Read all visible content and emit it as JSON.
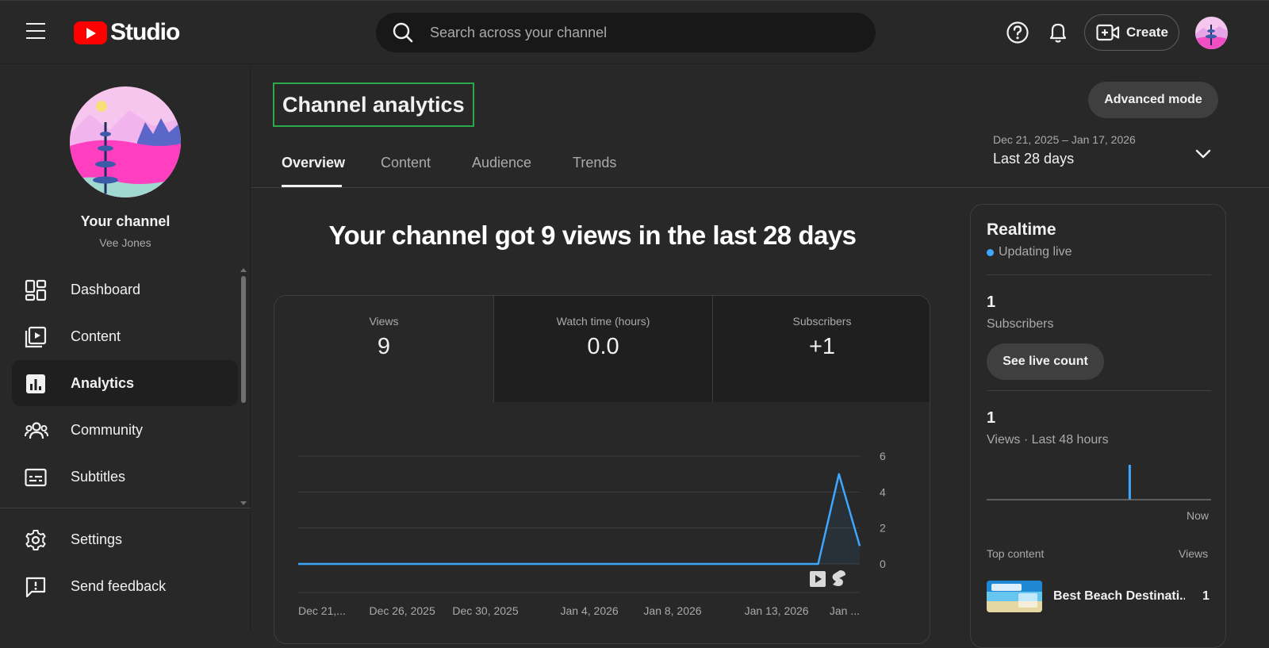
{
  "header": {
    "logo_text": "Studio",
    "search_placeholder": "Search across your channel",
    "create_label": "Create"
  },
  "sidebar": {
    "channel_title": "Your channel",
    "channel_name": "Vee Jones",
    "items": [
      {
        "label": "Dashboard",
        "icon": "dashboard-icon",
        "active": false
      },
      {
        "label": "Content",
        "icon": "content-icon",
        "active": false
      },
      {
        "label": "Analytics",
        "icon": "analytics-icon",
        "active": true
      },
      {
        "label": "Community",
        "icon": "community-icon",
        "active": false
      },
      {
        "label": "Subtitles",
        "icon": "subtitles-icon",
        "active": false
      }
    ],
    "bottom_items": [
      {
        "label": "Settings",
        "icon": "gear-icon"
      },
      {
        "label": "Send feedback",
        "icon": "feedback-icon"
      }
    ]
  },
  "main": {
    "title": "Channel analytics",
    "advanced_mode_label": "Advanced mode",
    "tabs": [
      {
        "label": "Overview",
        "active": true
      },
      {
        "label": "Content",
        "active": false
      },
      {
        "label": "Audience",
        "active": false
      },
      {
        "label": "Trends",
        "active": false
      }
    ],
    "date_range": "Dec 21, 2025 – Jan 17, 2026",
    "date_label": "Last 28 days",
    "headline": "Your channel got 9 views in the last 28 days",
    "metrics": [
      {
        "label": "Views",
        "value": "9"
      },
      {
        "label": "Watch time (hours)",
        "value": "0.0"
      },
      {
        "label": "Subscribers",
        "value": "+1"
      }
    ]
  },
  "chart_data": {
    "type": "area",
    "title": "",
    "xlabel": "",
    "ylabel": "",
    "ylim": [
      0,
      6
    ],
    "yticks": [
      "0",
      "2",
      "4",
      "6"
    ],
    "xtick_labels": [
      "Dec 21,...",
      "Dec 26, 2025",
      "Dec 30, 2025",
      "Jan 4, 2026",
      "Jan 8, 2026",
      "Jan 13, 2026",
      "Jan ..."
    ],
    "x": [
      1,
      2,
      3,
      4,
      5,
      6,
      7,
      8,
      9,
      10,
      11,
      12,
      13,
      14,
      15,
      16,
      17,
      18,
      19,
      20,
      21,
      22,
      23,
      24,
      25,
      26,
      27,
      28
    ],
    "values": [
      0,
      0,
      0,
      0,
      0,
      0,
      0,
      0,
      0,
      0,
      0,
      0,
      0,
      0,
      0,
      0,
      0,
      0,
      0,
      0,
      0,
      0,
      0,
      0,
      0,
      0,
      5,
      1
    ],
    "series_color": "#3ea6ff",
    "grid": true,
    "axis_side": "right"
  },
  "realtime": {
    "title": "Realtime",
    "live_text": "Updating live",
    "subscribers_value": "1",
    "subscribers_label": "Subscribers",
    "live_count_label": "See live count",
    "views_value": "1",
    "views_label": "Views · Last 48 hours",
    "now_label": "Now",
    "mini_chart": {
      "bars": 48,
      "peak_index": 30,
      "peak_value": 1
    },
    "top_content_label": "Top content",
    "top_views_label": "Views",
    "top_items": [
      {
        "title": "Best Beach Destinati...",
        "views": "1"
      }
    ]
  },
  "colors": {
    "accent": "#3ea6ff",
    "brand_red": "#ff0000",
    "highlight_border": "#2ba84a",
    "background": "#282828"
  }
}
